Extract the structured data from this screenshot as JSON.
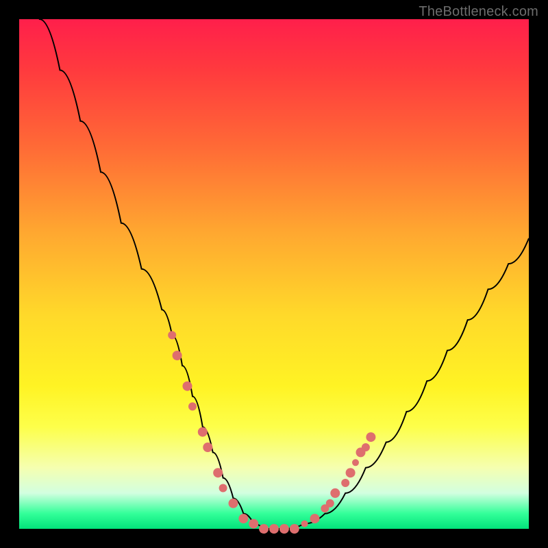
{
  "attribution": "TheBottleneck.com",
  "colors": {
    "page_bg": "#000000",
    "gradient_top": "#ff1f4b",
    "gradient_bottom": "#02e27a",
    "curve": "#000000",
    "marker": "#de6e6e",
    "attribution_text": "#6d6d6d"
  },
  "chart_data": {
    "type": "line",
    "title": "",
    "xlabel": "",
    "ylabel": "",
    "xlim": [
      0,
      100
    ],
    "ylim": [
      0,
      100
    ],
    "series": [
      {
        "name": "bottleneck-curve",
        "x": [
          0,
          4,
          8,
          12,
          16,
          20,
          24,
          28,
          30,
          32,
          34,
          36,
          38,
          40,
          42,
          44,
          46,
          48,
          50,
          52,
          56,
          60,
          64,
          68,
          72,
          76,
          80,
          84,
          88,
          92,
          96,
          100
        ],
        "y": [
          115,
          100,
          90,
          80,
          70,
          60,
          51,
          43,
          38,
          32,
          26,
          20,
          15,
          10,
          6,
          3,
          1,
          0,
          0,
          0,
          1,
          3,
          7,
          12,
          17,
          23,
          29,
          35,
          41,
          47,
          52,
          57
        ]
      }
    ],
    "markers": {
      "name": "highlight-points",
      "points": [
        {
          "x": 30,
          "y": 38,
          "r": 6
        },
        {
          "x": 31,
          "y": 34,
          "r": 7
        },
        {
          "x": 33,
          "y": 28,
          "r": 7
        },
        {
          "x": 34,
          "y": 24,
          "r": 6
        },
        {
          "x": 36,
          "y": 19,
          "r": 7
        },
        {
          "x": 37,
          "y": 16,
          "r": 7
        },
        {
          "x": 39,
          "y": 11,
          "r": 7
        },
        {
          "x": 40,
          "y": 8,
          "r": 6
        },
        {
          "x": 42,
          "y": 5,
          "r": 7
        },
        {
          "x": 44,
          "y": 2,
          "r": 7
        },
        {
          "x": 46,
          "y": 1,
          "r": 7
        },
        {
          "x": 48,
          "y": 0,
          "r": 7
        },
        {
          "x": 50,
          "y": 0,
          "r": 7
        },
        {
          "x": 52,
          "y": 0,
          "r": 7
        },
        {
          "x": 54,
          "y": 0,
          "r": 7
        },
        {
          "x": 56,
          "y": 1,
          "r": 5
        },
        {
          "x": 58,
          "y": 2,
          "r": 7
        },
        {
          "x": 60,
          "y": 4,
          "r": 6
        },
        {
          "x": 61,
          "y": 5,
          "r": 6
        },
        {
          "x": 62,
          "y": 7,
          "r": 7
        },
        {
          "x": 64,
          "y": 9,
          "r": 6
        },
        {
          "x": 65,
          "y": 11,
          "r": 7
        },
        {
          "x": 66,
          "y": 13,
          "r": 5
        },
        {
          "x": 67,
          "y": 15,
          "r": 7
        },
        {
          "x": 68,
          "y": 16,
          "r": 6
        },
        {
          "x": 69,
          "y": 18,
          "r": 7
        }
      ]
    }
  }
}
